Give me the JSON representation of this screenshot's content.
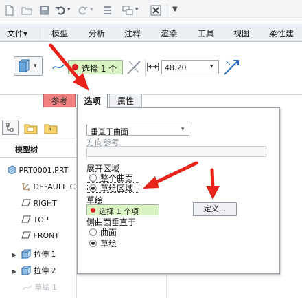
{
  "ribbon_menu": [
    "文件▾",
    "模型",
    "分析",
    "注释",
    "渲染",
    "工具",
    "视图",
    "柔性建"
  ],
  "ribbon": {
    "select_label": "选择 1 个",
    "depth_value": "48.20"
  },
  "dashboard_tabs": [
    "参考",
    "选项",
    "属性"
  ],
  "options_panel": {
    "direction_type": "垂直于曲面",
    "direction_ref_label": "方向参考",
    "expand_area_label": "展开区域",
    "expand_options": [
      "整个曲面",
      "草绘区域"
    ],
    "expand_selected": "草绘区域",
    "sketch_label": "草绘",
    "sketch_select": "选择 1 个项",
    "define_button": "定义...",
    "side_surface_label": "侧曲面垂直于",
    "side_options": [
      "曲面",
      "草绘"
    ],
    "side_selected": "草绘"
  },
  "model_tree": {
    "title": "模型树",
    "items": [
      "PRT0001.PRT",
      "DEFAULT_C",
      "RIGHT",
      "TOP",
      "FRONT",
      "拉伸 1",
      "拉伸 2",
      "草绘 1"
    ]
  },
  "colors": {
    "active_tab_bg": "#f08080",
    "arrow_red": "#e8231b",
    "select_box_bg": "#d9f2c2",
    "dot_red": "#d81e1e"
  }
}
